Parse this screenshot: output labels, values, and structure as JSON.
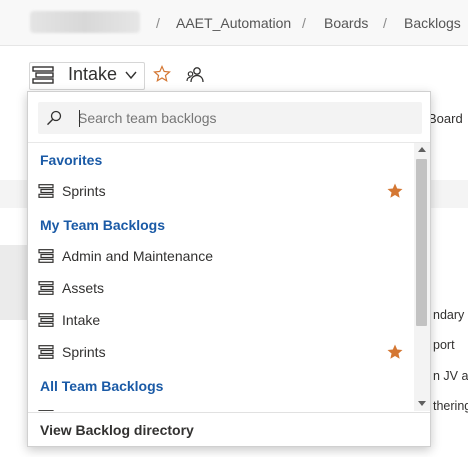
{
  "breadcrumb": {
    "project": "AAET_Automation",
    "hub": "Boards",
    "page": "Backlogs",
    "separator": "/"
  },
  "header": {
    "title": "Intake"
  },
  "background": {
    "board_label": "Board",
    "partial_texts": [
      "ndary a",
      "port",
      "n JV an",
      "thering"
    ]
  },
  "dropdown": {
    "search": {
      "placeholder": "Search team backlogs",
      "value": ""
    },
    "groups": {
      "favorites": {
        "label": "Favorites",
        "items": [
          {
            "label": "Sprints",
            "favorite": true
          }
        ]
      },
      "my_team": {
        "label": "My Team Backlogs",
        "items": [
          {
            "label": "Admin and Maintenance",
            "favorite": false
          },
          {
            "label": "Assets",
            "favorite": false
          },
          {
            "label": "Intake",
            "favorite": false
          },
          {
            "label": "Sprints",
            "favorite": true
          }
        ]
      },
      "all_team": {
        "label": "All Team Backlogs"
      }
    },
    "footer_link": "View Backlog directory"
  },
  "colors": {
    "accent_link": "#1a5aa6",
    "favorite_star": "#d47733",
    "text": "#323130"
  },
  "icons": {
    "backlog": "backlog-icon",
    "star": "star-icon",
    "search": "search-icon",
    "team": "team-icon"
  }
}
